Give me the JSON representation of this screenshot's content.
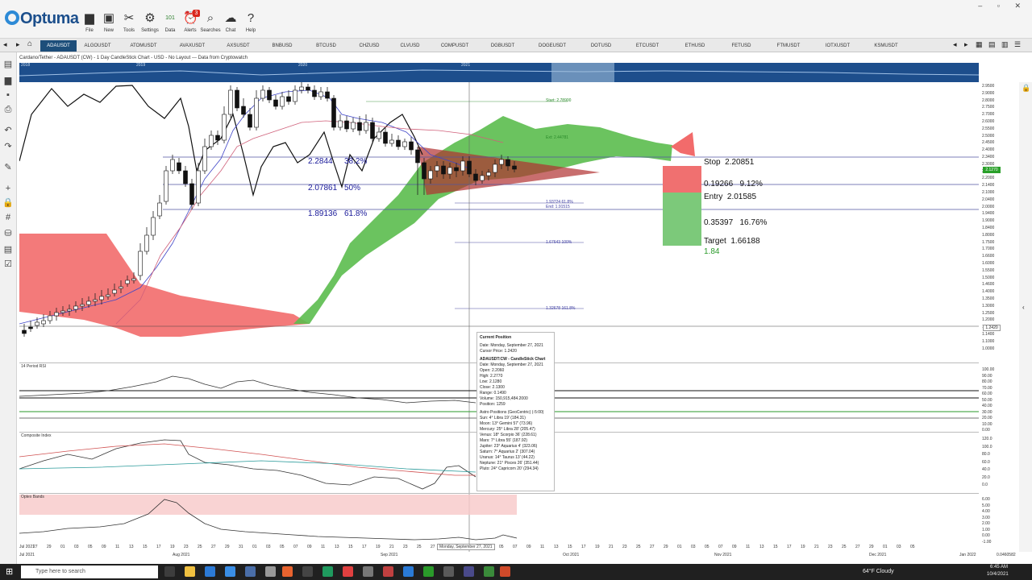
{
  "app": {
    "name": "Optuma",
    "window_controls": [
      "–",
      "▫",
      "✕"
    ]
  },
  "toolbar": [
    {
      "label": "File",
      "icon": "folder-icon"
    },
    {
      "label": "New",
      "icon": "new-window-icon"
    },
    {
      "label": "Tools",
      "icon": "tools-icon"
    },
    {
      "label": "Settings",
      "icon": "gear-icon"
    },
    {
      "label": "Data",
      "icon": "binary-data-icon"
    },
    {
      "label": "Alerts",
      "icon": "alarm-clock-icon",
      "badge": "3"
    },
    {
      "label": "Searches",
      "icon": "magnifier-icon"
    },
    {
      "label": "Chat",
      "icon": "chat-icon"
    },
    {
      "label": "Help",
      "icon": "question-icon"
    }
  ],
  "tabs": [
    "ADAUSDT",
    "ALGOUSDT",
    "ATOMUSDT",
    "AVAXUSDT",
    "AXSUSDT",
    "BNBUSD",
    "BTCUSD",
    "CHZUSD",
    "CLVUSD",
    "COMPUSDT",
    "DGBUSDT",
    "DOGEUSDT",
    "DOTUSD",
    "ETCUSDT",
    "ETHUSD",
    "FETUSD",
    "FTMUSDT",
    "IOTXUSDT",
    "KSMUSDT"
  ],
  "active_tab": "ADAUSDT",
  "chart_caption": "Cardano/Tether - ADAUSDT (CW) - 1 Day CandleStick Chart - USD - No Layout --- Data from Cryptowatch",
  "overview_years": [
    "2018",
    "2019",
    "2020",
    "2021"
  ],
  "fib_retracements": [
    {
      "value": "2.2844",
      "pct": "38.2%"
    },
    {
      "value": "2.07861",
      "pct": "50%"
    },
    {
      "value": "1.89136",
      "pct": "61.8%"
    }
  ],
  "fib_small": {
    "start": "Start: 2.78900",
    "ext": "Ext: 2.44781",
    "l618": "1.93724  61.8%",
    "end": "End: 1.91515",
    "l100": "1.67643  100%",
    "l1618": "1.32678  161.8%"
  },
  "trade": {
    "stop_label": "Stop",
    "stop": "2.20851",
    "risk": "0.19266",
    "risk_pct": "9.12%",
    "entry_label": "Entry",
    "entry": "2.01585",
    "reward": "0.35397",
    "reward_pct": "16.76%",
    "target_label": "Target",
    "target": "1.66188",
    "ratio": "1.84"
  },
  "price_axis": [
    "2.9500",
    "2.9000",
    "2.8000",
    "2.7500",
    "2.7000",
    "2.6000",
    "2.5500",
    "2.5000",
    "2.4500",
    "2.4000",
    "2.3400",
    "2.3000",
    "2.2500",
    "2.2000",
    "2.1400",
    "2.1000",
    "2.0400",
    "2.0000",
    "1.9400",
    "1.9000",
    "1.8400",
    "1.8000",
    "1.7500",
    "1.7000",
    "1.6600",
    "1.6000",
    "1.5500",
    "1.5000",
    "1.4600",
    "1.4000",
    "1.3500",
    "1.3000",
    "1.2500",
    "1.2000",
    "1.1600",
    "1.1400",
    "1.1000",
    "1.0000"
  ],
  "current_price_tag": "2.1270",
  "cursor_price_tag": "1.2420",
  "rsi": {
    "label": "14 Period RSI",
    "axis": [
      "100.00",
      "90.00",
      "80.00",
      "70.00",
      "60.00",
      "50.00",
      "40.00",
      "30.00",
      "20.00",
      "10.00",
      "0.00"
    ]
  },
  "composite": {
    "label": "Composite Index",
    "axis": [
      "120.0",
      "100.0",
      "80.0",
      "60.0",
      "40.0",
      "20.0",
      "0.0"
    ]
  },
  "optex": {
    "label": "Optex Bands",
    "axis": [
      "6.00",
      "5.00",
      "4.00",
      "3.00",
      "2.00",
      "1.00",
      "0.00",
      "-1.00"
    ]
  },
  "date_axis": {
    "days": [
      "Jul 2021",
      "27",
      "29",
      "01",
      "03",
      "05",
      "09",
      "11",
      "13",
      "15",
      "17",
      "19",
      "23",
      "25",
      "27",
      "29",
      "31",
      "01",
      "03",
      "05",
      "07",
      "09",
      "11",
      "13",
      "15",
      "17",
      "19",
      "21",
      "23",
      "25",
      "27",
      "29",
      "31",
      "01",
      "03",
      "05",
      "07",
      "09",
      "11",
      "13",
      "15",
      "17",
      "19",
      "21",
      "23",
      "25",
      "27",
      "29",
      "01",
      "03",
      "05",
      "07",
      "09",
      "11",
      "13",
      "15",
      "17",
      "19",
      "21",
      "23",
      "25",
      "27",
      "29",
      "01",
      "03",
      "05"
    ],
    "months": [
      {
        "label": "Jul 2021"
      },
      {
        "label": "Aug 2021"
      },
      {
        "label": "Sep 2021"
      },
      {
        "label": "Oct 2021"
      },
      {
        "label": "Nov 2021"
      },
      {
        "label": "Dec 2021"
      },
      {
        "label": "Jan 2022"
      }
    ],
    "cursor_date": "Monday, September 27, 2021",
    "right_value": "0.0460582"
  },
  "tooltip": {
    "title1": "Current Position",
    "date1": "Date: Monday, September 27, 2021",
    "cursor": "Cursor Price: 1.2420",
    "title2": "ADAUSDT:CW - CandleStick Chart",
    "date2": "Date: Monday, September 27, 2021",
    "open": "Open: 2.2060",
    "high": "High: 2.2770",
    "low": "Low: 2.1280",
    "close": "Close: 2.1300",
    "range": "Range: 0.1490",
    "volume": "Volume: 150,915,484.2000",
    "position": "Position: 1259",
    "astro_title": "Astro Positions (GeoCentric) (-5:00)",
    "astro": [
      "Sun: 4° Libra 19' (184.31)",
      "Moon: 13° Gemini 57' (73.96)",
      "Mercury: 25° Libra 28' (205.47)",
      "Venus: 18° Scorpio 36' (228.61)",
      "Mars: 7° Libra 55' (187.92)",
      "Jupiter: 23° Aquarius 4' (323.06)",
      "Saturn: 7° Aquarius 2' (307.04)",
      "Uranus: 14° Taurus 13' (44.22)",
      "Neptune: 21° Pisces 26' (351.44)",
      "Pluto: 24° Capricorn 20' (294.34)"
    ]
  },
  "taskbar": {
    "search_placeholder": "Type here to search",
    "weather": "64°F  Cloudy",
    "time": "6:45 AM",
    "date": "10/4/2021"
  },
  "colors": {
    "accent": "#1d4e7a",
    "bear_cloud": "#f26b6b",
    "bull_cloud": "#5bbd4e",
    "triangle": "#b03030"
  }
}
